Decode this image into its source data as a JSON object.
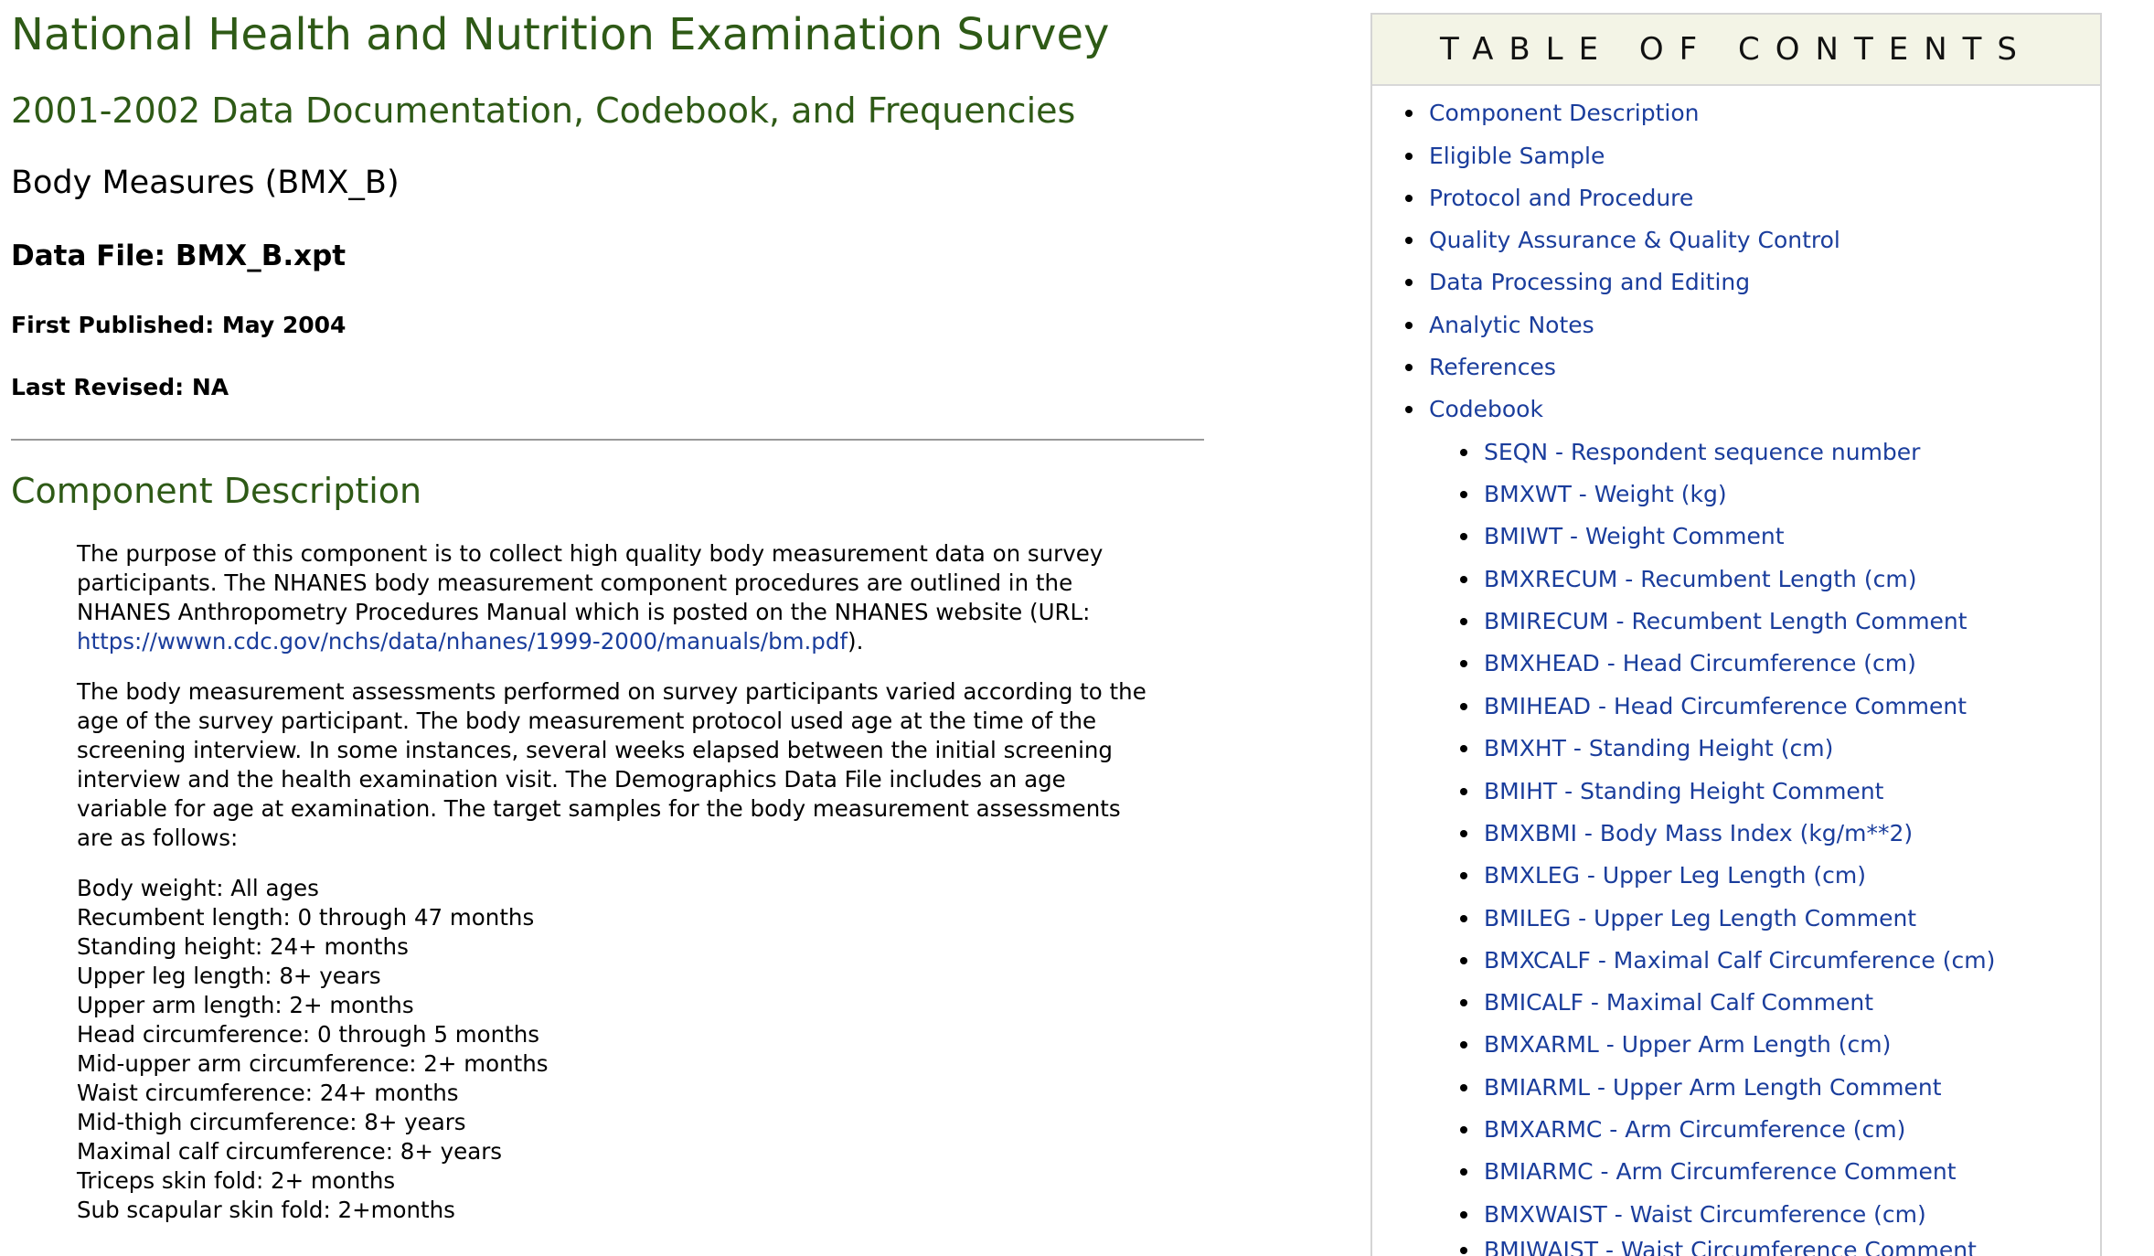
{
  "header": {
    "title": "National Health and Nutrition Examination Survey",
    "subtitle": "2001-2002 Data Documentation, Codebook, and Frequencies",
    "component": "Body Measures (BMX_B)",
    "data_file": "Data File: BMX_B.xpt",
    "first_published": "First Published: May 2004",
    "last_revised": "Last Revised: NA"
  },
  "component_description": {
    "heading": "Component Description",
    "para1_text": "The purpose of this component is to collect high quality body measurement data on survey participants. The NHANES body measurement component procedures are outlined in the NHANES Anthropometry Procedures Manual which is posted on the NHANES website (URL: ",
    "para1_link": "https://wwwn.cdc.gov/nchs/data/nhanes/1999-2000/manuals/bm.pdf",
    "para1_end": ").",
    "para2": "The body measurement assessments performed on survey participants varied according to the age of the survey participant. The body measurement protocol used age at the time of the screening interview. In some instances, several weeks elapsed between the initial screening interview and the health examination visit. The Demographics Data File includes an age variable for age at examination. The target samples for the body measurement assessments are as follows:",
    "targets": [
      "Body weight: All ages",
      "Recumbent length: 0 through 47 months",
      "Standing height: 24+ months",
      "Upper leg length: 8+ years",
      "Upper arm length: 2+ months",
      "Head circumference: 0 through 5 months",
      "Mid-upper arm circumference: 2+ months",
      "Waist circumference: 24+ months",
      "Mid-thigh circumference: 8+ years",
      "Maximal calf circumference: 8+ years",
      "Triceps skin fold: 2+ months",
      "Sub scapular skin fold: 2+months"
    ]
  },
  "toc": {
    "title": "TABLE OF CONTENTS",
    "sections": [
      "Component Description",
      "Eligible Sample",
      "Protocol and Procedure",
      "Quality Assurance & Quality Control",
      "Data Processing and Editing",
      "Analytic Notes",
      "References",
      "Codebook"
    ],
    "codebook": [
      "SEQN - Respondent sequence number",
      "BMXWT - Weight (kg)",
      "BMIWT - Weight Comment",
      "BMXRECUM - Recumbent Length (cm)",
      "BMIRECUM - Recumbent Length Comment",
      "BMXHEAD - Head Circumference (cm)",
      "BMIHEAD - Head Circumference Comment",
      "BMXHT - Standing Height (cm)",
      "BMIHT - Standing Height Comment",
      "BMXBMI - Body Mass Index (kg/m**2)",
      "BMXLEG - Upper Leg Length (cm)",
      "BMILEG - Upper Leg Length Comment",
      "BMXCALF - Maximal Calf Circumference (cm)",
      "BMICALF - Maximal Calf Comment",
      "BMXARML - Upper Arm Length (cm)",
      "BMIARML - Upper Arm Length Comment",
      "BMXARMC - Arm Circumference (cm)",
      "BMIARMC - Arm Circumference Comment",
      "BMXWAIST - Waist Circumference (cm)",
      "BMIWAIST - Waist Circumference Comment"
    ]
  },
  "colors": {
    "heading_green": "#2e5a16",
    "link_blue": "#1a3d9c",
    "toc_header_bg": "#f3f4e6"
  }
}
